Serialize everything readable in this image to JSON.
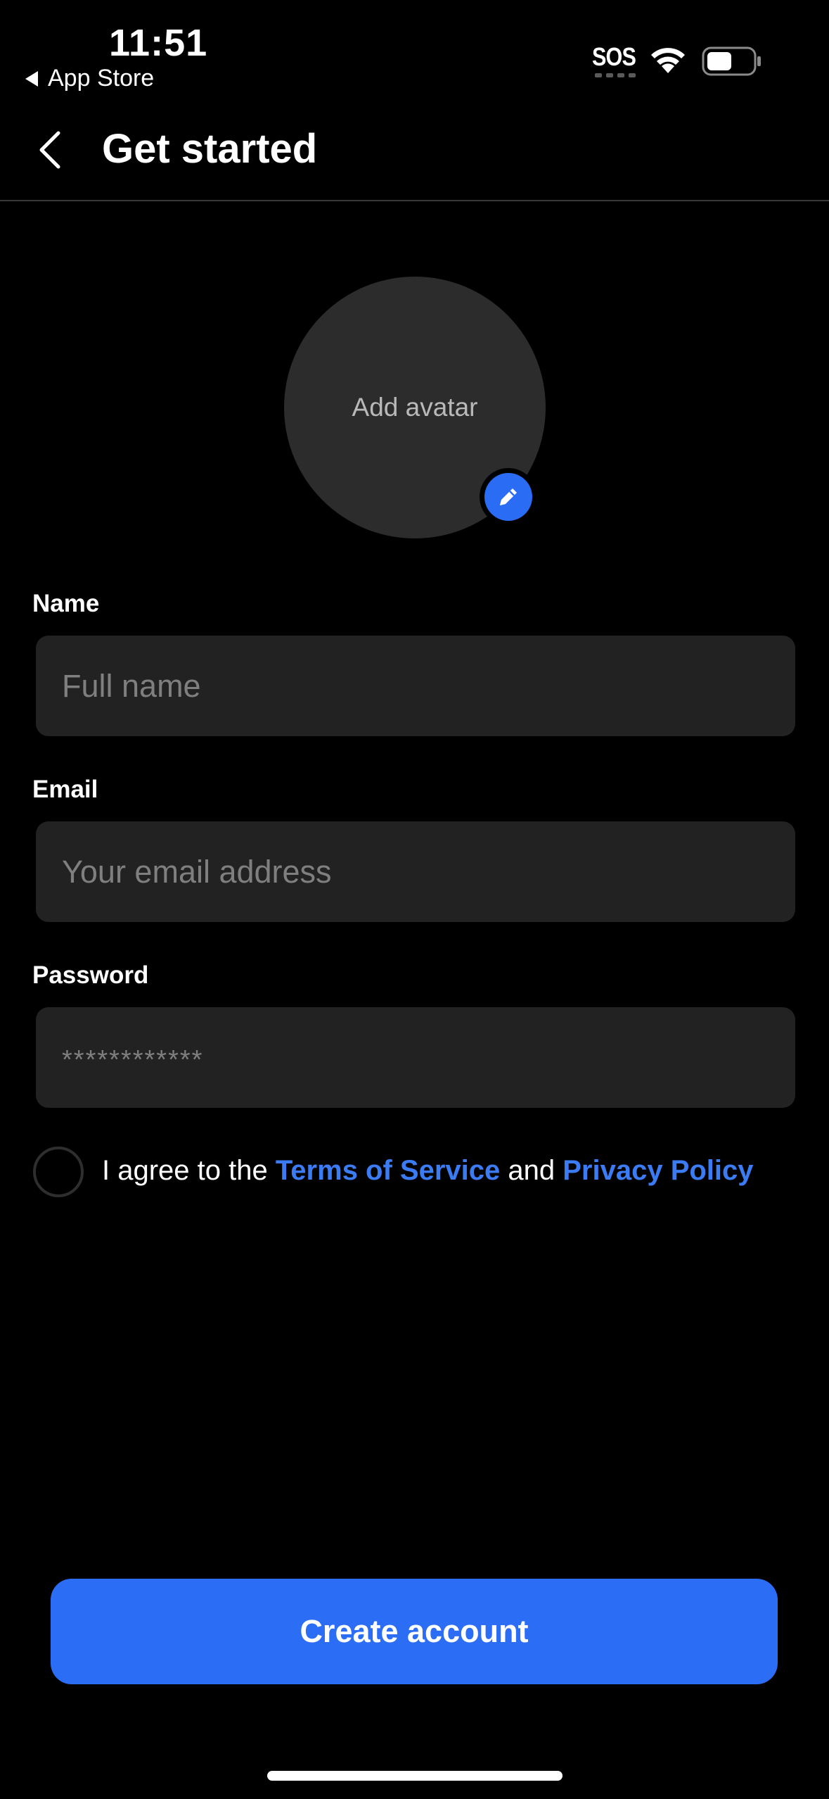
{
  "status_bar": {
    "time": "11:51",
    "back_app": "App Store",
    "sos": "SOS"
  },
  "header": {
    "title": "Get started"
  },
  "avatar": {
    "label": "Add avatar"
  },
  "form": {
    "name_label": "Name",
    "name_placeholder": "Full name",
    "email_label": "Email",
    "email_placeholder": "Your email address",
    "password_label": "Password",
    "password_placeholder": "************"
  },
  "agreement": {
    "prefix": "I agree to the ",
    "terms_link": "Terms of Service",
    "middle": " and ",
    "privacy_link": "Privacy Policy"
  },
  "primary_button": {
    "label": "Create account"
  },
  "colors": {
    "accent": "#2b6ef5",
    "link": "#3b7cf5",
    "background": "#000000",
    "input_bg": "#222222"
  }
}
